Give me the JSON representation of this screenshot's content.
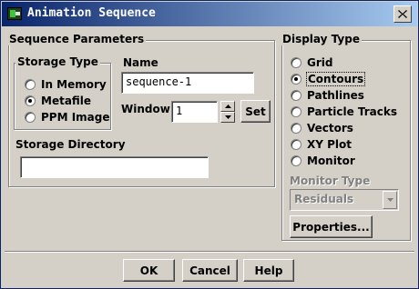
{
  "window": {
    "title": "Animation Sequence"
  },
  "sequence_parameters": {
    "title": "Sequence Parameters",
    "storage_type": {
      "title": "Storage Type",
      "options": [
        "In Memory",
        "Metafile",
        "PPM Image"
      ],
      "selected": "Metafile"
    },
    "name_label": "Name",
    "name_value": "sequence-1",
    "window_label": "Window",
    "window_value": "1",
    "set_label": "Set",
    "storage_directory_label": "Storage Directory",
    "storage_directory_value": ""
  },
  "display_type": {
    "title": "Display Type",
    "options": [
      "Grid",
      "Contours",
      "Pathlines",
      "Particle Tracks",
      "Vectors",
      "XY Plot",
      "Monitor"
    ],
    "selected": "Contours",
    "monitor_type_label": "Monitor Type",
    "monitor_type_value": "Residuals",
    "properties_label": "Properties..."
  },
  "footer": {
    "ok_label": "OK",
    "cancel_label": "Cancel",
    "help_label": "Help"
  },
  "icons": {
    "app": "app-window-icon",
    "close": "close-icon",
    "spin_up": "arrow-up-icon",
    "spin_down": "arrow-down-icon",
    "dropdown": "chevron-down-icon"
  }
}
